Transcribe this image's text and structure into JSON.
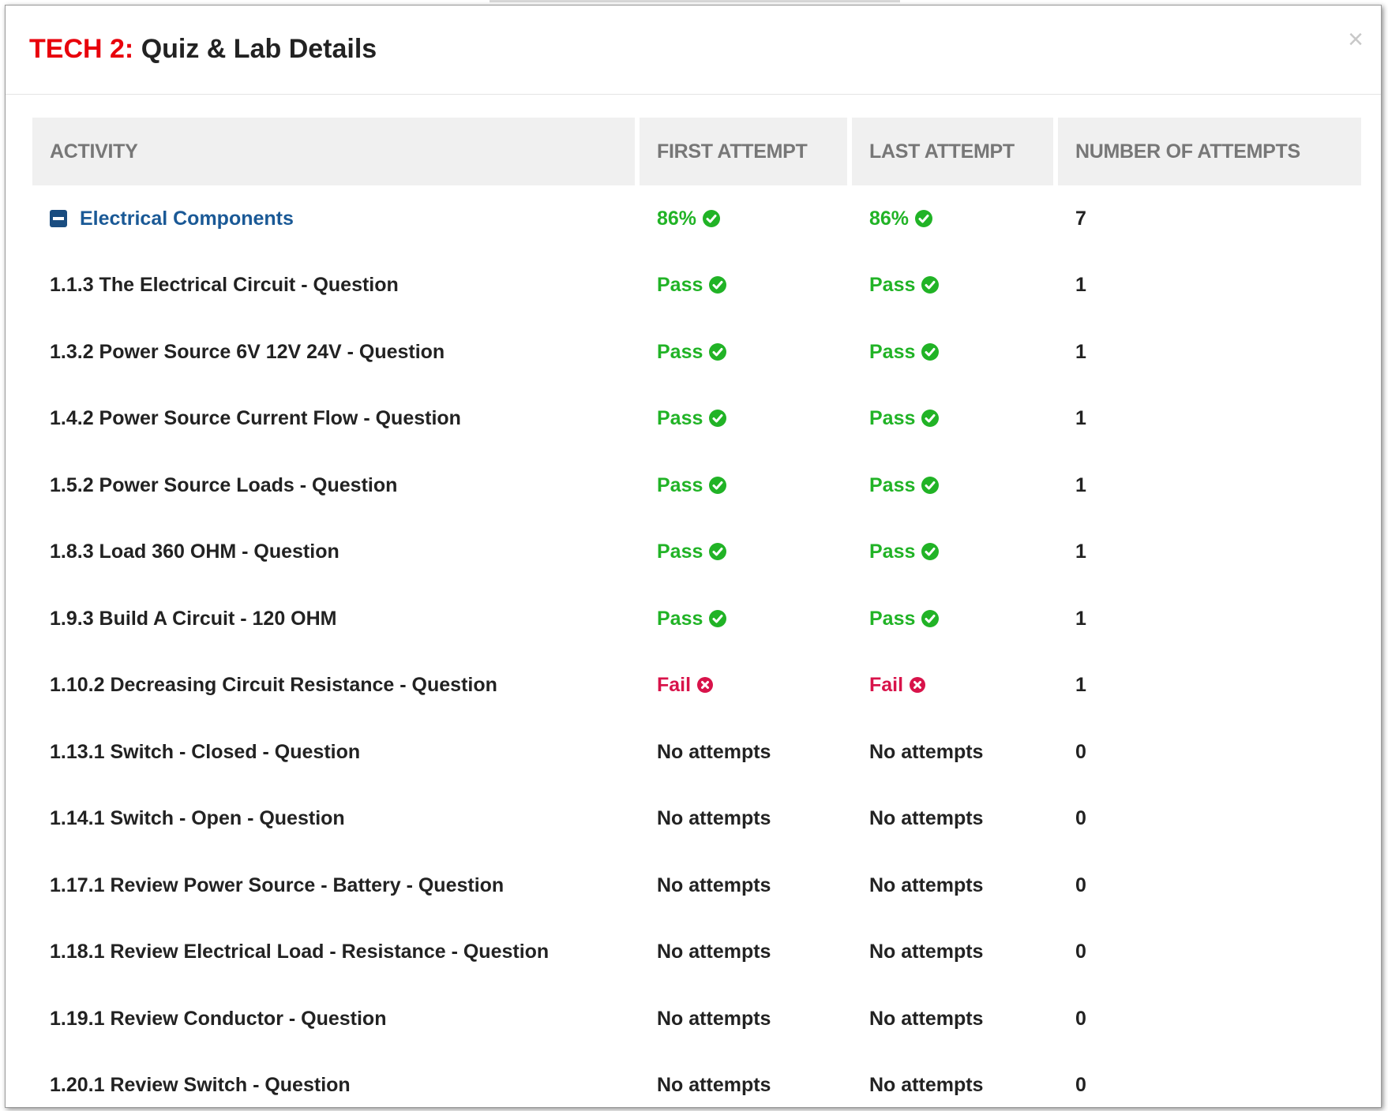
{
  "modal": {
    "title_prefix": "TECH 2:",
    "title": "Quiz & Lab Details",
    "close_glyph": "×"
  },
  "table": {
    "headers": [
      "ACTIVITY",
      "FIRST ATTEMPT",
      "LAST ATTEMPT",
      "NUMBER OF ATTEMPTS"
    ],
    "group": {
      "name": "Electrical Components",
      "icon": "minus-square-icon",
      "first": "86%",
      "last": "86%",
      "attempts": "7"
    },
    "rows": [
      {
        "activity": "1.1.3 The Electrical Circuit - Question",
        "first": "Pass",
        "last": "Pass",
        "attempts": "1"
      },
      {
        "activity": "1.3.2 Power Source 6V 12V 24V - Question",
        "first": "Pass",
        "last": "Pass",
        "attempts": "1"
      },
      {
        "activity": "1.4.2 Power Source Current Flow - Question",
        "first": "Pass",
        "last": "Pass",
        "attempts": "1"
      },
      {
        "activity": "1.5.2 Power Source Loads - Question",
        "first": "Pass",
        "last": "Pass",
        "attempts": "1"
      },
      {
        "activity": "1.8.3 Load 360 OHM - Question",
        "first": "Pass",
        "last": "Pass",
        "attempts": "1"
      },
      {
        "activity": "1.9.3 Build A Circuit - 120 OHM",
        "first": "Pass",
        "last": "Pass",
        "attempts": "1"
      },
      {
        "activity": "1.10.2 Decreasing Circuit Resistance - Question",
        "first": "Fail",
        "last": "Fail",
        "attempts": "1"
      },
      {
        "activity": "1.13.1 Switch - Closed - Question",
        "first": "No attempts",
        "last": "No attempts",
        "attempts": "0"
      },
      {
        "activity": "1.14.1 Switch - Open - Question",
        "first": "No attempts",
        "last": "No attempts",
        "attempts": "0"
      },
      {
        "activity": "1.17.1 Review Power Source - Battery - Question",
        "first": "No attempts",
        "last": "No attempts",
        "attempts": "0"
      },
      {
        "activity": "1.18.1 Review Electrical Load - Resistance - Question",
        "first": "No attempts",
        "last": "No attempts",
        "attempts": "0"
      },
      {
        "activity": "1.19.1 Review Conductor - Question",
        "first": "No attempts",
        "last": "No attempts",
        "attempts": "0"
      },
      {
        "activity": "1.20.1 Review Switch - Question",
        "first": "No attempts",
        "last": "No attempts",
        "attempts": "0"
      }
    ]
  },
  "colors": {
    "pass": "#21b326",
    "fail": "#d8134a",
    "title_prefix": "#e8000b",
    "group_link": "#1a5996",
    "header_bg": "#f0f0f0"
  }
}
